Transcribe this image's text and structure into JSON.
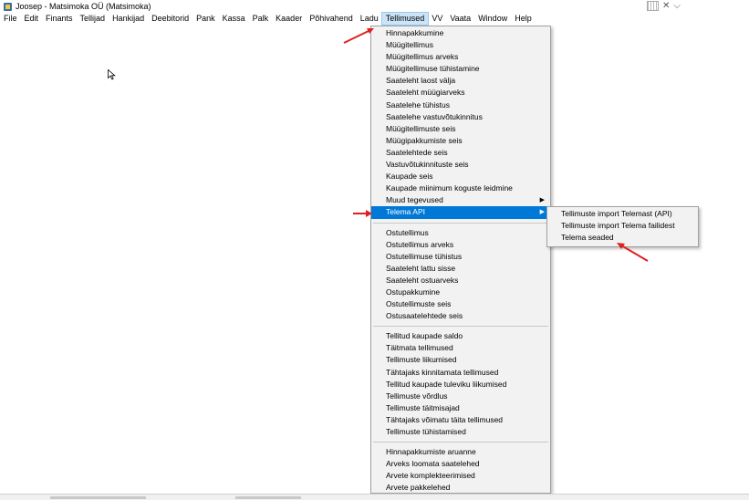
{
  "window": {
    "title": "Joosep - Matsimoka OÜ (Matsimoka)"
  },
  "menubar": {
    "items": [
      "File",
      "Edit",
      "Finants",
      "Tellijad",
      "Hankijad",
      "Deebitorid",
      "Pank",
      "Kassa",
      "Palk",
      "Kaader",
      "Põhivahend",
      "Ladu",
      "Tellimused",
      "VV",
      "Vaata",
      "Window",
      "Help"
    ],
    "active": "Tellimused"
  },
  "tellimused_menu": {
    "group1": [
      "Hinnapakkumine",
      "Müügitellimus",
      "Müügitellimus arveks",
      "Müügitellimuse tühistamine",
      "Saateleht laost välja",
      "Saateleht müügiarveks",
      "Saatelehe tühistus",
      "Saatelehe vastuvõtukinnitus",
      "Müügitellimuste seis",
      "Müügipakkumiste seis",
      "Saatelehtede seis",
      "Vastuvõtukinnituste seis",
      "Kaupade seis",
      "Kaupade miinimum koguste leidmine"
    ],
    "muud": "Muud tegevused",
    "telema": "Telema API",
    "group2": [
      "Ostutellimus",
      "Ostutellimus arveks",
      "Ostutellimuse tühistus",
      "Saateleht lattu sisse",
      "Saateleht ostuarveks",
      "Ostupakkumine",
      "Ostutellimuste seis",
      "Ostusaatelehtede seis"
    ],
    "group3": [
      "Tellitud kaupade saldo",
      "Täitmata tellimused",
      "Tellimuste liikumised",
      "Tähtajaks kinnitamata tellimused",
      "Tellitud kaupade tuleviku liikumised",
      "Tellimuste võrdlus",
      "Tellimuste täitmisajad",
      "Tähtajaks võimatu täita tellimused",
      "Tellimuste tühistamised"
    ],
    "group4": [
      "Hinnapakkumiste aruanne",
      "Arveks loomata saatelehed",
      "Arvete komplekteerimised",
      "Arvete pakkelehed"
    ]
  },
  "telema_submenu": {
    "items": [
      "Tellimuste import Telemast (API)",
      "Tellimuste import Telema failidest",
      "Telema seaded"
    ]
  },
  "colors": {
    "highlight": "#0078d7",
    "annotation_arrow": "#e02020",
    "menu_bg": "#f2f2f2"
  },
  "icons": {
    "submenu_arrow": "▶",
    "window_down": "chevron-down-icon"
  }
}
